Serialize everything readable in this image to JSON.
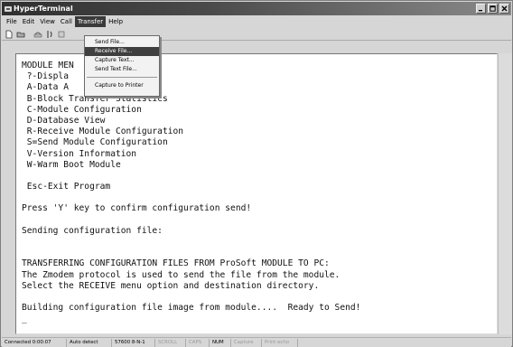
{
  "window": {
    "title": "HyperTerminal",
    "icon": "hyperterminal-icon"
  },
  "menubar": {
    "items": [
      {
        "label": "File"
      },
      {
        "label": "Edit"
      },
      {
        "label": "View"
      },
      {
        "label": "Call"
      },
      {
        "label": "Transfer"
      },
      {
        "label": "Help"
      }
    ],
    "active": "Transfer"
  },
  "transfer_menu": {
    "items": [
      {
        "label": "Send File..."
      },
      {
        "label": "Receive File..."
      },
      {
        "label": "Capture Text..."
      },
      {
        "label": "Send Text File..."
      },
      {
        "label": "Capture to Printer"
      }
    ],
    "highlighted": "Receive File..."
  },
  "terminal": {
    "lines": [
      "MODULE MEN",
      " ?-Displa",
      " A-Data A",
      " B-Block Transfer Statistics",
      " C-Module Configuration",
      " D-Database View",
      " R-Receive Module Configuration",
      " S=Send Module Configuration",
      " V-Version Information",
      " W-Warm Boot Module",
      "",
      " Esc-Exit Program",
      "",
      "Press 'Y' key to confirm configuration send!",
      "",
      "Sending configuration file:",
      "",
      "",
      "TRANSFERRING CONFIGURATION FILES FROM ProSoft MODULE TO PC:",
      "The Zmodem protocol is used to send the file from the module.",
      "Select the RECEIVE menu option and destination directory.",
      "",
      "Building configuration file image from module....  Ready to Send!",
      "_"
    ]
  },
  "statusbar": {
    "connected": "Connected 0:00:07",
    "detect": "Auto detect",
    "baud": "57600 8-N-1",
    "scroll": "SCROLL",
    "caps": "CAPS",
    "num": "NUM",
    "capture": "Capture",
    "print_echo": "Print echo"
  }
}
